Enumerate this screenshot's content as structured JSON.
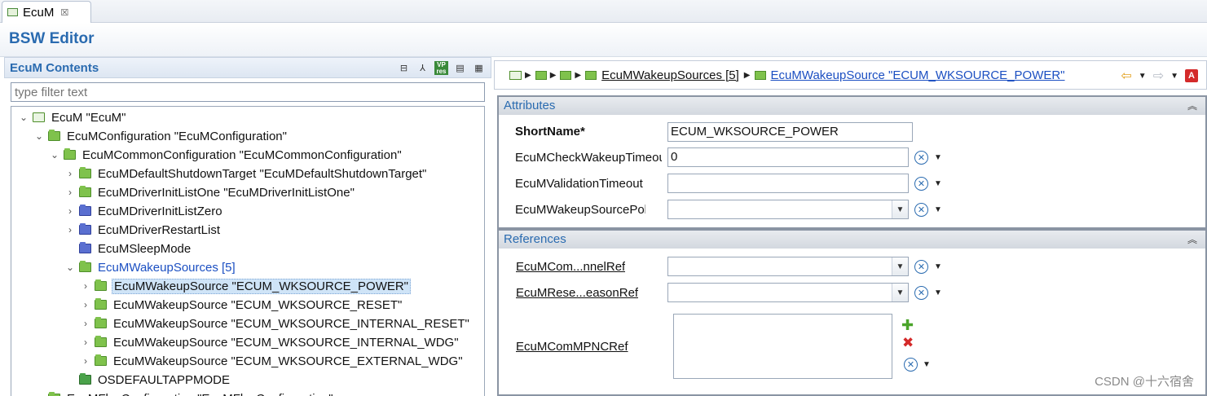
{
  "tab": {
    "label": "EcuM",
    "close": "☒"
  },
  "editor": {
    "title": "BSW Editor"
  },
  "left": {
    "title": "EcuM Contents",
    "filter_placeholder": "type filter text",
    "tools": [
      "collapse-all-icon",
      "link-icon",
      "vp-res-icon",
      "document-icon",
      "grid-icon"
    ],
    "vp_label": "VP res"
  },
  "tree": [
    {
      "label": "EcuM \"EcuM\"",
      "indent": 0,
      "expander": "open",
      "icon": "module"
    },
    {
      "label": "EcuMConfiguration \"EcuMConfiguration\"",
      "indent": 1,
      "expander": "open",
      "icon": "green"
    },
    {
      "label": "EcuMCommonConfiguration \"EcuMCommonConfiguration\"",
      "indent": 2,
      "expander": "open",
      "icon": "green"
    },
    {
      "label": "EcuMDefaultShutdownTarget \"EcuMDefaultShutdownTarget\"",
      "indent": 3,
      "expander": "closed",
      "icon": "green"
    },
    {
      "label": "EcuMDriverInitListOne \"EcuMDriverInitListOne\"",
      "indent": 3,
      "expander": "closed",
      "icon": "green"
    },
    {
      "label": "EcuMDriverInitListZero",
      "indent": 3,
      "expander": "closed",
      "icon": "blue"
    },
    {
      "label": "EcuMDriverRestartList",
      "indent": 3,
      "expander": "closed",
      "icon": "blue"
    },
    {
      "label": "EcuMSleepMode",
      "indent": 3,
      "expander": "none",
      "icon": "blue"
    },
    {
      "label": "EcuMWakeupSources [5]",
      "indent": 3,
      "expander": "open",
      "icon": "green",
      "link": true
    },
    {
      "label": "EcuMWakeupSource \"ECUM_WKSOURCE_POWER\"",
      "indent": 4,
      "expander": "closed",
      "icon": "green",
      "selected": true
    },
    {
      "label": "EcuMWakeupSource \"ECUM_WKSOURCE_RESET\"",
      "indent": 4,
      "expander": "closed",
      "icon": "green"
    },
    {
      "label": "EcuMWakeupSource \"ECUM_WKSOURCE_INTERNAL_RESET\"",
      "indent": 4,
      "expander": "closed",
      "icon": "green"
    },
    {
      "label": "EcuMWakeupSource \"ECUM_WKSOURCE_INTERNAL_WDG\"",
      "indent": 4,
      "expander": "closed",
      "icon": "green"
    },
    {
      "label": "EcuMWakeupSource \"ECUM_WKSOURCE_EXTERNAL_WDG\"",
      "indent": 4,
      "expander": "closed",
      "icon": "green"
    },
    {
      "label": "OSDEFAULTAPPMODE",
      "indent": 3,
      "expander": "none",
      "icon": "app"
    },
    {
      "label": "EcuMFlexConfiguration \"EcuMFlexConfiguration\"",
      "indent": 1,
      "expander": "closed",
      "icon": "green"
    }
  ],
  "breadcrumb": {
    "wakeup_sources": "EcuMWakeupSources [5]",
    "current": "EcuMWakeupSource \"ECUM_WKSOURCE_POWER\""
  },
  "attributes": {
    "title": "Attributes",
    "short_name_label": "ShortName*",
    "short_name_value": "ECUM_WKSOURCE_POWER",
    "check_wakeup_label": "EcuMCheckWakeupTimeout",
    "check_wakeup_value": "0",
    "validation_label": "EcuMValidationTimeout",
    "validation_value": "",
    "source_polling_label": "EcuMWakeupSourcePolling",
    "source_polling_value": ""
  },
  "references": {
    "title": "References",
    "comm_channel_label": "EcuMCom...nnelRef",
    "reset_reason_label": "EcuMRese...easonRef",
    "pnc_label": "EcuMComMPNCRef"
  },
  "watermark": "CSDN @十六宿舍"
}
